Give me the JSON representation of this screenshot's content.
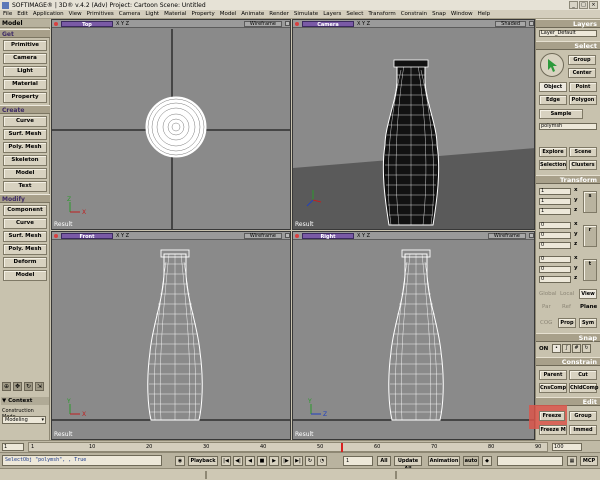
{
  "window": {
    "title": "SOFTIMAGE® | 3D® v.4.2 (Adv) Project: Cartoon   Scene: Untitled"
  },
  "menu": [
    "File",
    "Edit",
    "Application",
    "View",
    "Primitives",
    "Camera",
    "Light",
    "Material",
    "Property",
    "Model",
    "Animate",
    "Render",
    "Simulate",
    "Layers",
    "Select",
    "Transform",
    "Constrain",
    "Snap",
    "Window",
    "Help"
  ],
  "left": {
    "header": "Model",
    "get_label": "Get",
    "get_items": [
      "Primitive",
      "Camera",
      "Light",
      "Material",
      "Property"
    ],
    "create_label": "Create",
    "create_items": [
      "Curve",
      "Surf. Mesh",
      "Poly. Mesh",
      "Skeleton",
      "Model",
      "Text"
    ],
    "modify_label": "Modify",
    "modify_items": [
      "Component",
      "Curve",
      "Surf. Mesh",
      "Poly. Mesh",
      "Deform",
      "Model"
    ],
    "context_label": "▼ Context",
    "construction_mode_label": "Construction Mode",
    "construction_mode_value": "Modeling"
  },
  "viewports": [
    {
      "camera": "Top",
      "mode": "Wireframe",
      "label": "Result",
      "xyz": "X Y Z"
    },
    {
      "camera": "Camera",
      "mode": "Shaded",
      "label": "Result",
      "xyz": "X Y Z"
    },
    {
      "camera": "Front",
      "mode": "Wireframe",
      "label": "Result",
      "xyz": "X Y Z"
    },
    {
      "camera": "Right",
      "mode": "Wireframe",
      "label": "Result",
      "xyz": "X Y Z"
    }
  ],
  "right": {
    "layers_label": "Layers",
    "layer_value": "Layer_Default",
    "select_label": "Select",
    "group_label": "Group",
    "center_label": "Center",
    "object_label": "Object",
    "point_label": "Point",
    "edge_label": "Edge",
    "polygon_label": "Polygon",
    "sample_label": "Sample",
    "selected_value": "polymsh",
    "explore_label": "Explore",
    "scene_label": "Scene",
    "selection_label": "Selection",
    "clusters_label": "Clusters",
    "transform_label": "Transform",
    "scale_values": [
      "1",
      "1",
      "1"
    ],
    "rot_values": [
      "0",
      "0",
      "0"
    ],
    "trans_values": [
      "0",
      "0",
      "0"
    ],
    "axis_letters": [
      "x",
      "y",
      "z"
    ],
    "global_label": "Global",
    "local_label": "Local",
    "view_label": "View",
    "par_label": "Par",
    "ref_label": "Ref",
    "plane_label": "Plane",
    "cog_label": "COG",
    "prop_label": "Prop",
    "sym_label": "Sym",
    "snap_label": "Snap",
    "on_label": "ON",
    "constrain_label": "Constrain",
    "parent_label": "Parent",
    "cut_label": "Cut",
    "cnscomp_label": "CnsComp",
    "chldcomp_label": "ChldComp",
    "edit_label": "Edit",
    "freeze_label": "Freeze",
    "group2_label": "Group",
    "freezem_label": "Freeze M",
    "immed_label": "Immed"
  },
  "timeline": {
    "ticks": [
      "1",
      "10",
      "20",
      "30",
      "40",
      "50",
      "60",
      "70",
      "80",
      "90",
      "100"
    ],
    "end_value": "100",
    "start_value": "1"
  },
  "playback": {
    "playback_label": "Playback",
    "frame_value": "1",
    "all_label": "All",
    "update_label": "Update All",
    "animation_label": "Animation",
    "auto_label": "auto"
  },
  "status": {
    "script_text": "SelectObj \"polymsh\", , True",
    "mcp_label": "MCP"
  },
  "colors": {
    "accent": "#7a5aa6",
    "highlight": "#d9554a"
  }
}
